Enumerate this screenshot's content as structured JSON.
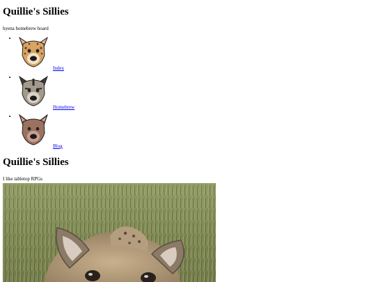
{
  "header": {
    "title": "Quillie's Sillies",
    "tagline": "hyena homebrew hoard"
  },
  "nav": {
    "items": [
      {
        "label": "Index",
        "icon": "hyena-spotted-icon"
      },
      {
        "label": "Homebrew",
        "icon": "hyena-striped-icon"
      },
      {
        "label": "Blog",
        "icon": "hyena-brown-icon"
      }
    ]
  },
  "main": {
    "title": "Quillie's Sillies",
    "text": "I like tabletop RPGs"
  },
  "colors": {
    "link": "#0000ee",
    "spotted": "#c9955a",
    "striped": "#a59a8a",
    "brown": "#9b7160",
    "grass": "#7f8a56"
  }
}
